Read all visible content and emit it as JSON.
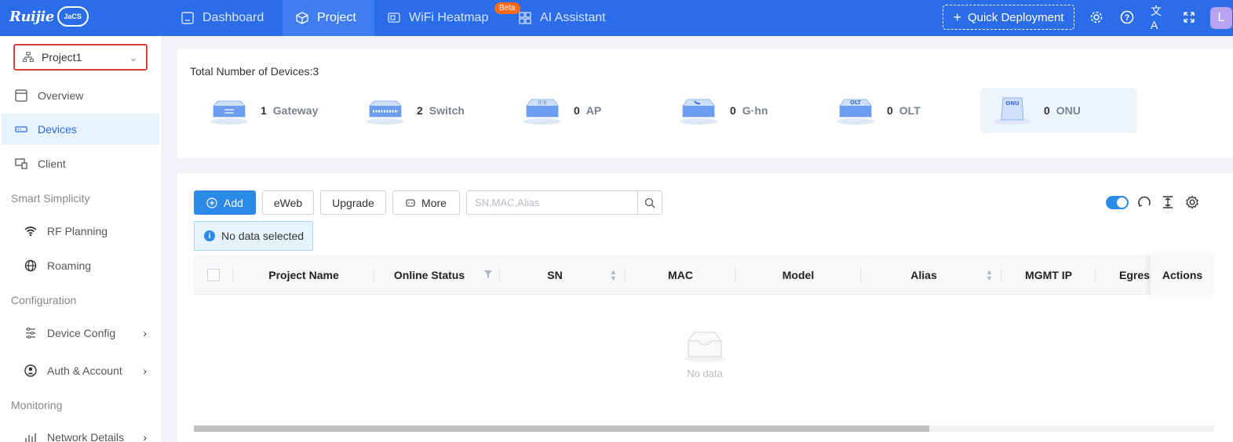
{
  "topbar": {
    "logo_text": "Ruijie",
    "logo_badge": "JaCS",
    "nav": [
      {
        "label": "Dashboard",
        "icon": "dashboard-icon"
      },
      {
        "label": "Project",
        "icon": "cube-icon",
        "active": true
      },
      {
        "label": "WiFi Heatmap",
        "icon": "heatmap-icon"
      },
      {
        "label": "AI Assistant",
        "icon": "apps-grid-icon"
      }
    ],
    "beta_badge": "Beta",
    "quick_deploy_label": "Quick Deployment",
    "avatar_initial": "L"
  },
  "sidebar": {
    "project_name": "Project1",
    "items": [
      {
        "label": "Overview",
        "icon": "overview-icon"
      },
      {
        "label": "Devices",
        "icon": "devices-icon",
        "active": true
      },
      {
        "label": "Client",
        "icon": "client-icon"
      }
    ],
    "groups": [
      "Smart Simplicity",
      "Configuration",
      "Monitoring"
    ],
    "smart_items": [
      {
        "label": "RF Planning",
        "icon": "wifi-icon"
      },
      {
        "label": "Roaming",
        "icon": "globe-icon"
      }
    ],
    "config_items": [
      {
        "label": "Device Config",
        "icon": "sliders-icon"
      },
      {
        "label": "Auth & Account",
        "icon": "user-circle-icon"
      }
    ],
    "monitoring_items": [
      {
        "label": "Network Details",
        "icon": "bar-chart-icon"
      }
    ]
  },
  "summary": {
    "title": "Total Number of Devices:3",
    "device_types": [
      {
        "count": "1",
        "label": "Gateway"
      },
      {
        "count": "2",
        "label": "Switch"
      },
      {
        "count": "0",
        "label": "AP"
      },
      {
        "count": "0",
        "label": "G·hn"
      },
      {
        "count": "0",
        "label": "OLT"
      },
      {
        "count": "0",
        "label": "ONU"
      }
    ],
    "device_badges": {
      "ap": "((·))",
      "olt": "OLT",
      "onu": "ONU"
    }
  },
  "toolbar": {
    "add_label": "Add",
    "eweb_label": "eWeb",
    "upgrade_label": "Upgrade",
    "more_label": "More",
    "search_placeholder": "SN,MAC,Alias",
    "selection_info": "No data selected"
  },
  "table": {
    "columns": [
      "Project Name",
      "Online Status",
      "SN",
      "MAC",
      "Model",
      "Alias",
      "MGMT IP",
      "Egress",
      "Actions"
    ],
    "empty_text": "No data"
  },
  "colors": {
    "topbar": "#2b6de8",
    "accent": "#2b8ae8",
    "highlight_border": "#e0403a"
  }
}
